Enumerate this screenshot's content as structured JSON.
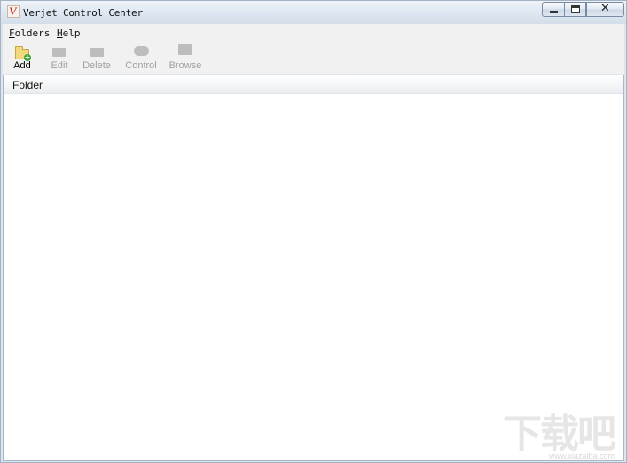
{
  "window": {
    "title": "Verjet Control Center",
    "icon_letter": "V",
    "controls": {
      "minimize": "minimize",
      "maximize": "maximize",
      "close": "✕"
    }
  },
  "menubar": {
    "items": [
      {
        "underline": "F",
        "rest": "olders"
      },
      {
        "underline": "H",
        "rest": "elp"
      }
    ]
  },
  "toolbar": {
    "buttons": [
      {
        "label": "Add",
        "icon": "folder-add-icon",
        "enabled": true
      },
      {
        "label": "Edit",
        "icon": "edit-icon",
        "enabled": false
      },
      {
        "label": "Delete",
        "icon": "delete-icon",
        "enabled": false
      },
      {
        "label": "Control",
        "icon": "control-icon",
        "enabled": false
      },
      {
        "label": "Browse",
        "icon": "browse-icon",
        "enabled": false
      }
    ]
  },
  "list": {
    "columns": [
      "Folder"
    ],
    "rows": []
  },
  "watermark": {
    "main": "下载吧",
    "url": "www.xiazaiba.com"
  },
  "colors": {
    "titlebar": "#dde7f1",
    "chrome": "#f1f1f1",
    "disabled_text": "#a0a0a0"
  }
}
